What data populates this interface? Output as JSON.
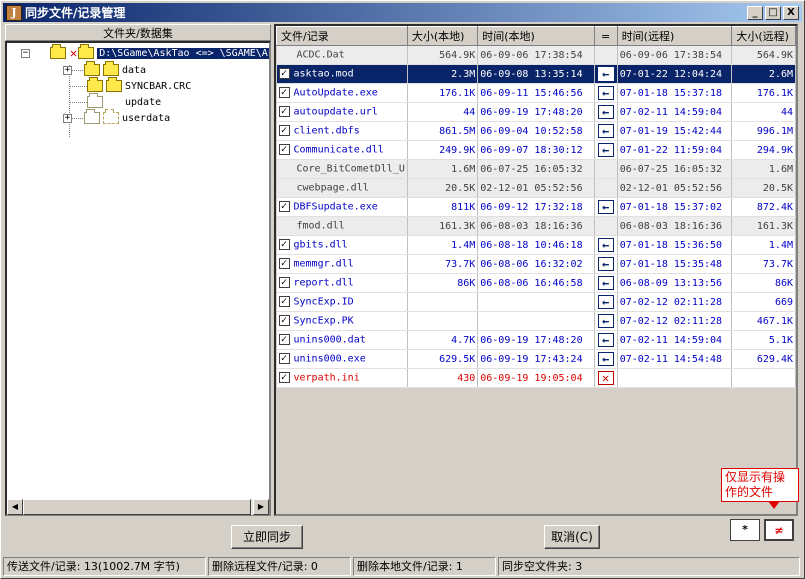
{
  "window": {
    "title": "同步文件/记录管理",
    "icon_glyph": "J",
    "buttons": [
      "_",
      "□",
      "X"
    ]
  },
  "left_pane": {
    "header": "文件夹/数据集",
    "root_label": "D:\\SGame\\AskTao <=> \\SGAME\\AskTao",
    "children": [
      {
        "label": "data",
        "expandable": true
      },
      {
        "label": "SYNCBAR.CRC",
        "expandable": false
      },
      {
        "label": "update",
        "expandable": false
      },
      {
        "label": "userdata",
        "expandable": true
      }
    ]
  },
  "table": {
    "columns": [
      "文件/记录",
      "大小(本地)",
      "时间(本地)",
      "=",
      "时间(远程)",
      "大小(远程)"
    ],
    "rows": [
      {
        "check": false,
        "name": "ACDC.Dat",
        "lsize": "564.9K",
        "ltime": "06-09-06 17:38:54",
        "op": "",
        "rtime": "06-09-06 17:38:54",
        "rsize": "564.9K",
        "style": "gray"
      },
      {
        "check": true,
        "name": "asktao.mod",
        "lsize": "2.3M",
        "ltime": "06-09-08 13:35:14",
        "op": "←",
        "rtime": "07-01-22 12:04:24",
        "rsize": "2.6M",
        "style": "sel"
      },
      {
        "check": true,
        "name": "AutoUpdate.exe",
        "lsize": "176.1K",
        "ltime": "06-09-11 15:46:56",
        "op": "←",
        "rtime": "07-01-18 15:37:18",
        "rsize": "176.1K",
        "style": "blue"
      },
      {
        "check": true,
        "name": "autoupdate.url",
        "lsize": "44",
        "ltime": "06-09-19 17:48:20",
        "op": "←",
        "rtime": "07-02-11 14:59:04",
        "rsize": "44",
        "style": "blue"
      },
      {
        "check": true,
        "name": "client.dbfs",
        "lsize": "861.5M",
        "ltime": "06-09-04 10:52:58",
        "op": "←",
        "rtime": "07-01-19 15:42:44",
        "rsize": "996.1M",
        "style": "blue"
      },
      {
        "check": true,
        "name": "Communicate.dll",
        "lsize": "249.9K",
        "ltime": "06-09-07 18:30:12",
        "op": "←",
        "rtime": "07-01-22 11:59:04",
        "rsize": "294.9K",
        "style": "blue"
      },
      {
        "check": false,
        "name": "Core_BitCometDll_U",
        "lsize": "1.6M",
        "ltime": "06-07-25 16:05:32",
        "op": "",
        "rtime": "06-07-25 16:05:32",
        "rsize": "1.6M",
        "style": "gray"
      },
      {
        "check": false,
        "name": "cwebpage.dll",
        "lsize": "20.5K",
        "ltime": "02-12-01 05:52:56",
        "op": "",
        "rtime": "02-12-01 05:52:56",
        "rsize": "20.5K",
        "style": "gray"
      },
      {
        "check": true,
        "name": "DBFSupdate.exe",
        "lsize": "811K",
        "ltime": "06-09-12 17:32:18",
        "op": "←",
        "rtime": "07-01-18 15:37:02",
        "rsize": "872.4K",
        "style": "blue"
      },
      {
        "check": false,
        "name": "fmod.dll",
        "lsize": "161.3K",
        "ltime": "06-08-03 18:16:36",
        "op": "",
        "rtime": "06-08-03 18:16:36",
        "rsize": "161.3K",
        "style": "gray"
      },
      {
        "check": true,
        "name": "gbits.dll",
        "lsize": "1.4M",
        "ltime": "06-08-18 10:46:18",
        "op": "←",
        "rtime": "07-01-18 15:36:50",
        "rsize": "1.4M",
        "style": "blue"
      },
      {
        "check": true,
        "name": "memmgr.dll",
        "lsize": "73.7K",
        "ltime": "06-08-06 16:32:02",
        "op": "←",
        "rtime": "07-01-18 15:35:48",
        "rsize": "73.7K",
        "style": "blue"
      },
      {
        "check": true,
        "name": "report.dll",
        "lsize": "86K",
        "ltime": "06-08-06 16:46:58",
        "op": "←",
        "rtime": "06-08-09 13:13:56",
        "rsize": "86K",
        "style": "blue"
      },
      {
        "check": true,
        "name": "SyncExp.ID",
        "lsize": "",
        "ltime": "",
        "op": "←",
        "rtime": "07-02-12 02:11:28",
        "rsize": "669",
        "style": "blue"
      },
      {
        "check": true,
        "name": "SyncExp.PK",
        "lsize": "",
        "ltime": "",
        "op": "←",
        "rtime": "07-02-12 02:11:28",
        "rsize": "467.1K",
        "style": "blue"
      },
      {
        "check": true,
        "name": "unins000.dat",
        "lsize": "4.7K",
        "ltime": "06-09-19 17:48:20",
        "op": "←",
        "rtime": "07-02-11 14:59:04",
        "rsize": "5.1K",
        "style": "blue"
      },
      {
        "check": true,
        "name": "unins000.exe",
        "lsize": "629.5K",
        "ltime": "06-09-19 17:43:24",
        "op": "←",
        "rtime": "07-02-11 14:54:48",
        "rsize": "629.4K",
        "style": "blue"
      },
      {
        "check": true,
        "name": "verpath.ini",
        "lsize": "430",
        "ltime": "06-09-19 19:05:04",
        "op": "✕",
        "rtime": "",
        "rsize": "",
        "style": "red"
      }
    ]
  },
  "buttons": {
    "sync_now": "立即同步",
    "cancel": "取消(C)",
    "show_all": "*",
    "show_diff": "≠"
  },
  "tooltip": "仅显示有操作的文件",
  "status": {
    "transfer": "传送文件/记录: 13(1002.7M 字节)",
    "delete_remote": "删除远程文件/记录: 0",
    "delete_local": "删除本地文件/记录: 1",
    "sync_empty": "同步空文件夹: 3"
  },
  "colors": {
    "title_bar": "#0a246a",
    "selected_row": "#0a246a",
    "pending_text": "#0000c8",
    "delete_text": "#e00000",
    "unchanged_text": "#404040"
  }
}
